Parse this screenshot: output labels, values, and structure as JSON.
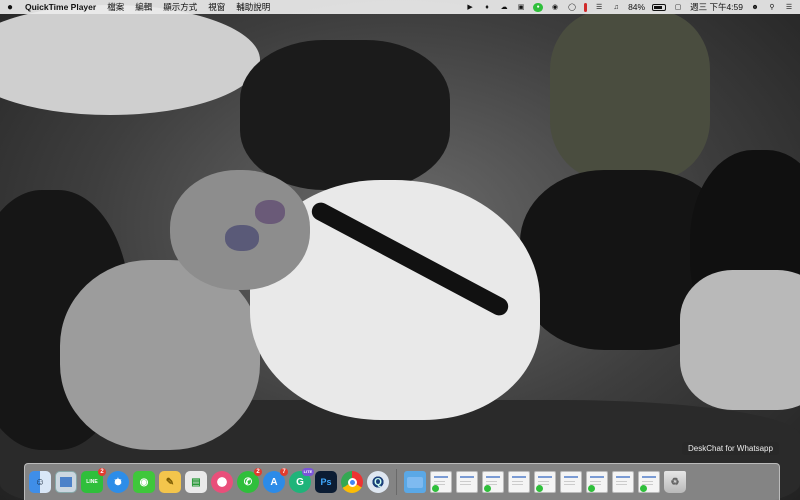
{
  "menubar": {
    "apple_icon": "apple-icon",
    "app_name": "QuickTime Player",
    "menus": [
      "檔案",
      "編輯",
      "顯示方式",
      "視窗",
      "輔助說明"
    ],
    "status": {
      "battery_percent": "84%",
      "battery_level": 0.84,
      "clock": "週三 下午4:59"
    }
  },
  "tooltip": {
    "text": "DeskChat for Whatsapp"
  },
  "colors": {
    "menubar_bg": "#ececec",
    "badge_red": "#e23b2e",
    "line_green": "#2fbf3b"
  },
  "dock": {
    "apps": [
      {
        "name": "finder-icon",
        "badge": ""
      },
      {
        "name": "preview-icon",
        "badge": ""
      },
      {
        "name": "line-icon",
        "badge": "2"
      },
      {
        "name": "safari-icon",
        "badge": ""
      },
      {
        "name": "wechat-icon",
        "badge": ""
      },
      {
        "name": "notes-icon",
        "badge": ""
      },
      {
        "name": "numbers-icon",
        "badge": ""
      },
      {
        "name": "itunes-icon",
        "badge": ""
      },
      {
        "name": "whatsapp-icon",
        "badge": "2"
      },
      {
        "name": "app-store-icon",
        "badge": "7"
      },
      {
        "name": "grammarly-icon",
        "badge": ""
      },
      {
        "name": "photoshop-icon",
        "badge": ""
      },
      {
        "name": "chrome-icon",
        "badge": ""
      },
      {
        "name": "quicktime-icon",
        "badge": ""
      }
    ],
    "documents": [
      "folder-icon",
      "doc-1",
      "doc-2",
      "doc-3",
      "doc-4",
      "doc-5",
      "doc-6",
      "doc-7",
      "doc-8",
      "doc-9",
      "doc-10"
    ],
    "labels": {
      "photoshop": "Ps",
      "grammarly_badge": "LITE",
      "line": "LINE"
    }
  }
}
